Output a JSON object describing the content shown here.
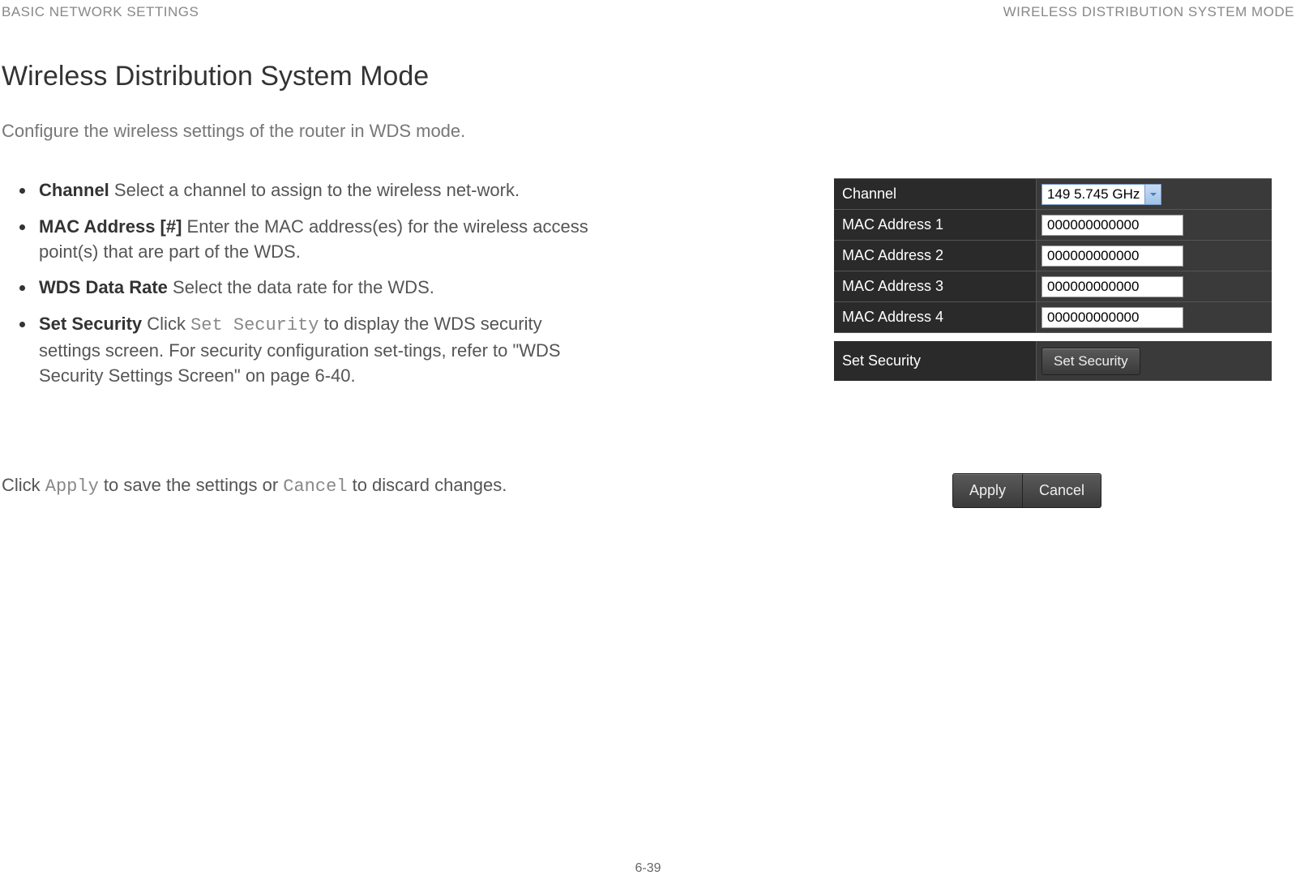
{
  "header": {
    "left": "BASIC NETWORK SETTINGS",
    "right": "WIRELESS DISTRIBUTION SYSTEM MODE"
  },
  "title": "Wireless Distribution System Mode",
  "intro": "Configure the wireless settings of the router in WDS mode.",
  "bullets": {
    "channel": {
      "label": "Channel",
      "text": "  Select a channel to assign to the wireless net-work."
    },
    "mac": {
      "label": "MAC Address [#]",
      "text": "  Enter the MAC address(es) for the wireless access point(s) that are part of the WDS."
    },
    "rate": {
      "label": "WDS Data Rate",
      "text": "  Select the data rate for the WDS."
    },
    "security": {
      "label": "Set Security",
      "pre": "  Click ",
      "mono": "Set Security",
      "post": " to display the WDS security settings screen. For security configuration set-tings, refer to \"WDS Security Settings Screen\" on page 6-40."
    }
  },
  "panel": {
    "channel_label": "Channel",
    "channel_value": "149  5.745 GHz",
    "mac1_label": "MAC Address 1",
    "mac1_value": "000000000000",
    "mac2_label": "MAC Address 2",
    "mac2_value": "000000000000",
    "mac3_label": "MAC Address 3",
    "mac3_value": "000000000000",
    "mac4_label": "MAC Address 4",
    "mac4_value": "000000000000",
    "security_label": "Set Security",
    "security_button": "Set Security"
  },
  "apply_cancel": {
    "pre": "Click ",
    "apply_mono": "Apply",
    "mid": " to save the settings or ",
    "cancel_mono": "Cancel",
    "post": " to discard changes.",
    "apply_btn": "Apply",
    "cancel_btn": "Cancel"
  },
  "page_number": "6-39"
}
